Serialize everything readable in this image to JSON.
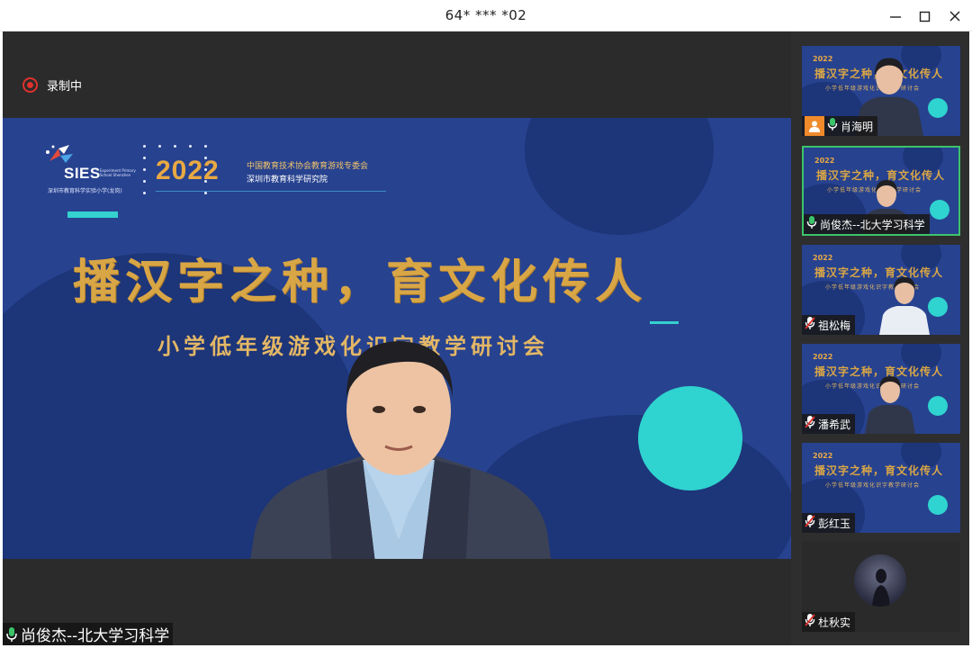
{
  "window": {
    "title": "64* *** *02",
    "minimize_icon": "minimize-icon",
    "maximize_icon": "maximize-icon",
    "close_icon": "close-icon"
  },
  "recording": {
    "label": "录制中",
    "icon": "record-icon",
    "color": "#e0312c"
  },
  "slide": {
    "logo_text": "SIES",
    "logo_subtitle": "深圳市教育科学实验小学(龙岗)",
    "logo_tagline": "Experiment Primary School Shenzhen",
    "year": "2022",
    "org_line1": "中国教育技术协会教育游戏专委会",
    "org_line2": "深圳市教育科学研究院",
    "headline": "播汉字之种，育文化传人",
    "subheadline": "小学低年级游戏化识字教学研讨会",
    "colors": {
      "background": "#27428f",
      "accent_teal": "#2fd3cf",
      "gold": "#d9a646"
    }
  },
  "main_speaker": {
    "name": "尚俊杰--北大学习科学",
    "mic_icon": "mic-on-icon"
  },
  "participants": [
    {
      "name": "肖海明",
      "mic": "mic-on-icon",
      "badge": "user-avatar-icon",
      "active": false
    },
    {
      "name": "尚俊杰--北大学习科学",
      "mic": "mic-on-icon",
      "active": true
    },
    {
      "name": "祖松梅",
      "mic": "mic-muted-icon",
      "active": false
    },
    {
      "name": "潘希武",
      "mic": "mic-muted-icon",
      "active": false
    },
    {
      "name": "彭红玉",
      "mic": "mic-muted-icon",
      "active": false
    },
    {
      "name": "杜秋实",
      "mic": "mic-muted-icon",
      "active": false
    }
  ]
}
